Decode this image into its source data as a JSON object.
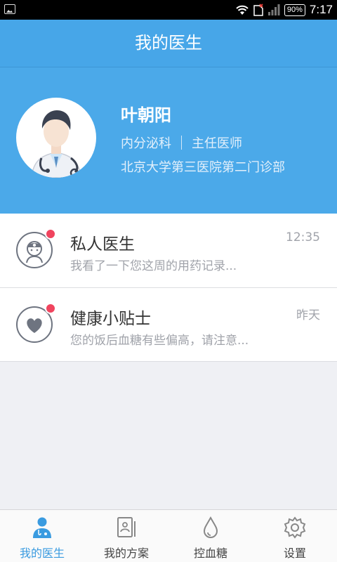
{
  "status_bar": {
    "battery": "90%",
    "time": "7:17"
  },
  "header": {
    "title": "我的医生"
  },
  "doctor": {
    "name": "叶朝阳",
    "department": "内分泌科",
    "position": "主任医师",
    "hospital": "北京大学第三医院第二门诊部"
  },
  "messages": [
    {
      "icon": "doctor-icon",
      "title": "私人医生",
      "preview": "我看了一下您这周的用药记录...",
      "time": "12:35",
      "unread": true
    },
    {
      "icon": "heart-icon",
      "title": "健康小贴士",
      "preview": "您的饭后血糖有些偏高，请注意...",
      "time": "昨天",
      "unread": true
    }
  ],
  "tabs": [
    {
      "label": "我的医生",
      "icon": "doctor-icon",
      "active": true
    },
    {
      "label": "我的方案",
      "icon": "plan-icon",
      "active": false
    },
    {
      "label": "控血糖",
      "icon": "drop-icon",
      "active": false
    },
    {
      "label": "设置",
      "icon": "gear-icon",
      "active": false
    }
  ],
  "colors": {
    "primary": "#47a6e8",
    "unread_dot": "#f0445e",
    "active_tab": "#3a9be0"
  }
}
